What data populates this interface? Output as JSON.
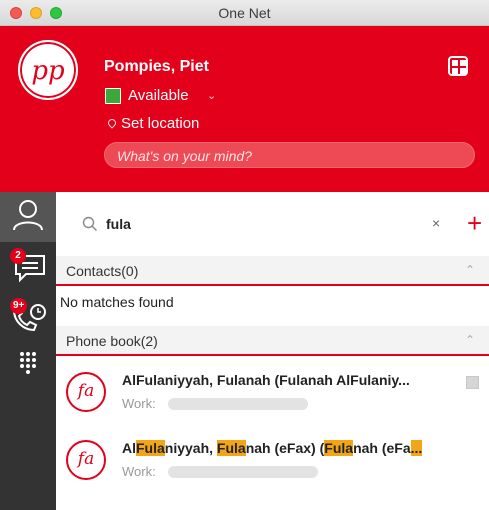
{
  "window": {
    "title": "One Net"
  },
  "profile": {
    "initials": "pp",
    "name": "Pompies, Piet",
    "status": "Available",
    "location": "Set location",
    "mind_placeholder": "What's on your mind?",
    "status_color": "#3aa83a",
    "brand_color": "#e2001a"
  },
  "sidebar": {
    "items": [
      {
        "icon": "contacts-icon",
        "active": true
      },
      {
        "icon": "chat-icon",
        "badge": "2"
      },
      {
        "icon": "call-history-icon",
        "badge": "9+"
      },
      {
        "icon": "dialpad-icon"
      }
    ]
  },
  "search": {
    "value": "fula",
    "clear": "×",
    "add": "+"
  },
  "contacts": {
    "label": "Contacts(0)",
    "empty": "No matches found"
  },
  "phonebook": {
    "label": "Phone book(2)",
    "results": [
      {
        "initials": "fa",
        "name": "AlFulaniyyah, Fulanah (Fulanah AlFulaniy...",
        "work_label": "Work:"
      },
      {
        "initials": "fa",
        "name_parts": [
          "Al",
          "Fula",
          "niyyah, ",
          "Fula",
          "nah (eFax) (",
          "Fula",
          "nah (eFa",
          "..."
        ],
        "work_label": "Work:"
      }
    ]
  }
}
